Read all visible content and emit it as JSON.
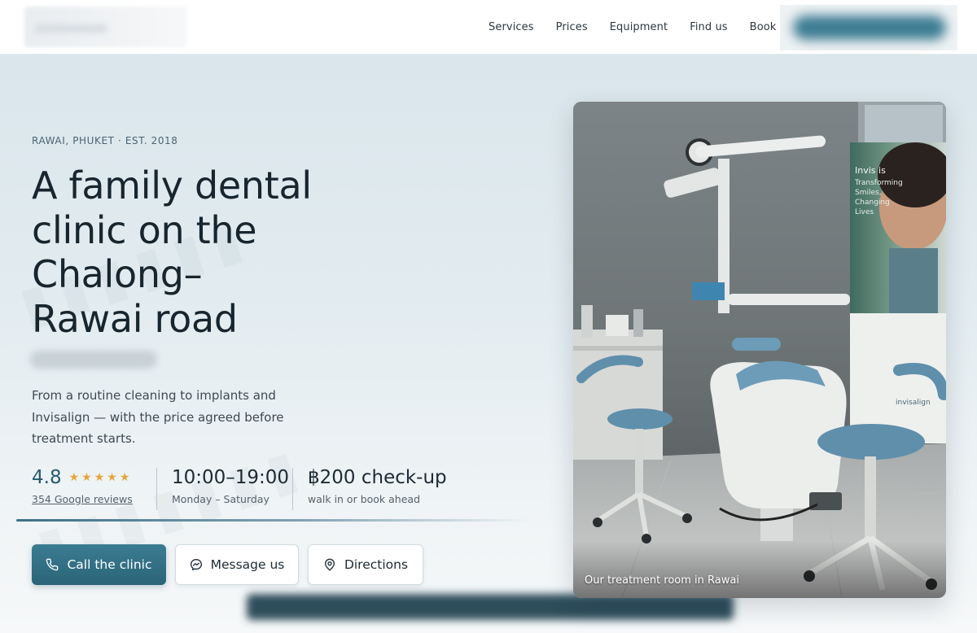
{
  "nav": {
    "items": [
      "Services",
      "Prices",
      "Equipment",
      "Find us",
      "Book"
    ]
  },
  "hero": {
    "eyebrow": "RAWAI, PHUKET · EST. 2018",
    "title_lines": [
      "A family dental",
      "clinic on the",
      "Chalong–",
      "Rawai road"
    ],
    "lead": "From a routine cleaning to implants and Invisalign — with the price agreed before treatment starts.",
    "stats": {
      "rating": {
        "value": "4.8",
        "stars": 5,
        "link": "354 Google reviews"
      },
      "hours": {
        "value": "10:00–19:00",
        "sub": "Monday – Saturday"
      },
      "price": {
        "value": "฿200 check-up",
        "sub": "walk in or book ahead"
      }
    },
    "buttons": {
      "call": "Call the clinic",
      "message": "Message us",
      "directions": "Directions"
    },
    "photo": {
      "caption": "Our treatment room in Rawai",
      "banner_text": [
        "Invis is",
        "Transforming",
        "Smiles,",
        "Changing",
        "Lives"
      ],
      "banner_logo": "invisalign"
    }
  },
  "icons": {
    "call": "phone-icon",
    "message": "messenger-icon",
    "directions": "map-pin-icon",
    "rating": "star-icon"
  },
  "colors": {
    "accent": "#2f6b80",
    "star": "#e3a638",
    "text": "#17252e"
  }
}
